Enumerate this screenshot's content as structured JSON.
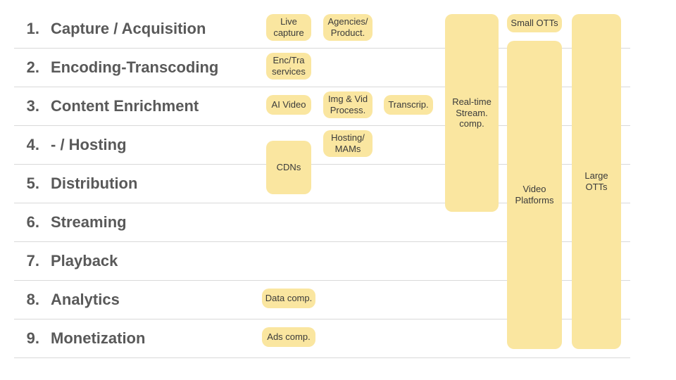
{
  "rows": [
    {
      "num": "1.",
      "label": "Capture / Acquisition"
    },
    {
      "num": "2.",
      "label": "Encoding-Transcoding"
    },
    {
      "num": "3.",
      "label": "Content Enrichment"
    },
    {
      "num": "4.",
      "label": "- / Hosting"
    },
    {
      "num": "5.",
      "label": "Distribution"
    },
    {
      "num": "6.",
      "label": "Streaming"
    },
    {
      "num": "7.",
      "label": "Playback"
    },
    {
      "num": "8.",
      "label": "Analytics"
    },
    {
      "num": "9.",
      "label": "Monetization"
    }
  ],
  "blocks": {
    "live_capture": "Live capture",
    "agencies": "Agencies/ Product.",
    "enc_tra": "Enc/Tra services",
    "ai_video": "AI Video",
    "img_vid": "Img & Vid Process.",
    "transcrip": "Transcrip.",
    "hosting_mams": "Hosting/ MAMs",
    "cdns": "CDNs",
    "data_comp": "Data comp.",
    "ads_comp": "Ads comp.",
    "realtime": "Real-time Stream. comp.",
    "small_otts": "Small OTTs",
    "video_platforms": "Video Platforms",
    "large_otts": "Large OTTs"
  }
}
